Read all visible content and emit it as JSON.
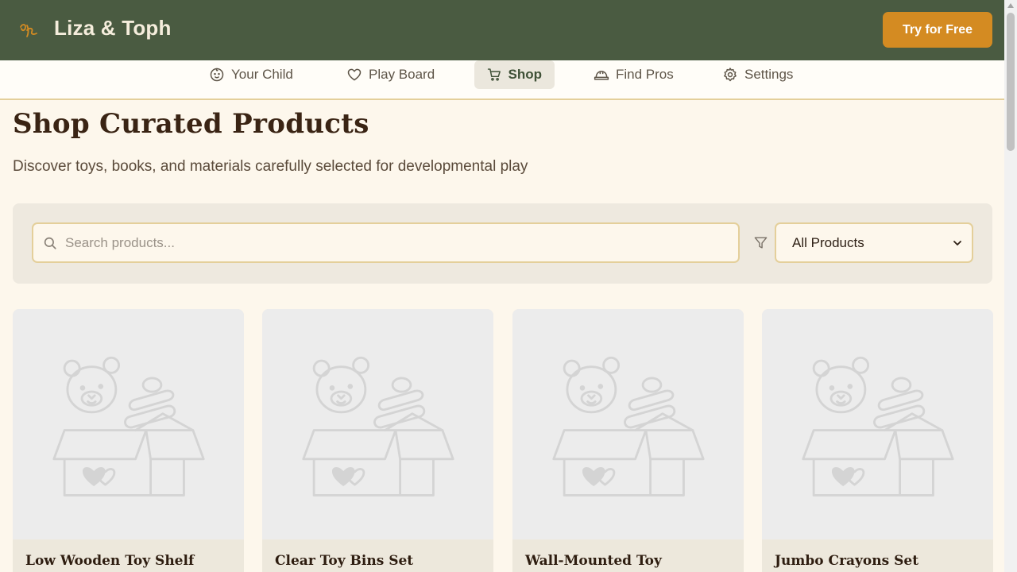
{
  "app": {
    "brand": "Liza & Toph",
    "cta_label": "Try for Free",
    "colors": {
      "header": "#4a5b41",
      "accent": "#d48b22",
      "background": "#fdf7ec"
    }
  },
  "nav": {
    "items": [
      {
        "label": "Your Child",
        "icon": "baby-face-icon",
        "active": false
      },
      {
        "label": "Play Board",
        "icon": "heart-icon",
        "active": false
      },
      {
        "label": "Shop",
        "icon": "cart-icon",
        "active": true
      },
      {
        "label": "Find Pros",
        "icon": "hard-hat-icon",
        "active": false
      },
      {
        "label": "Settings",
        "icon": "gear-icon",
        "active": false
      }
    ]
  },
  "page": {
    "title": "Shop Curated Products",
    "subtitle": "Discover toys, books, and materials carefully selected for developmental play"
  },
  "filters": {
    "search_placeholder": "Search products...",
    "search_value": "",
    "category_selected": "All Products"
  },
  "products": [
    {
      "name": "Low Wooden Toy Shelf",
      "image_icon": "toy-box-placeholder-icon"
    },
    {
      "name": "Clear Toy Bins Set",
      "image_icon": "toy-box-placeholder-icon"
    },
    {
      "name": "Wall-Mounted Toy",
      "image_icon": "toy-box-placeholder-icon"
    },
    {
      "name": "Jumbo Crayons Set",
      "image_icon": "toy-box-placeholder-icon"
    }
  ]
}
